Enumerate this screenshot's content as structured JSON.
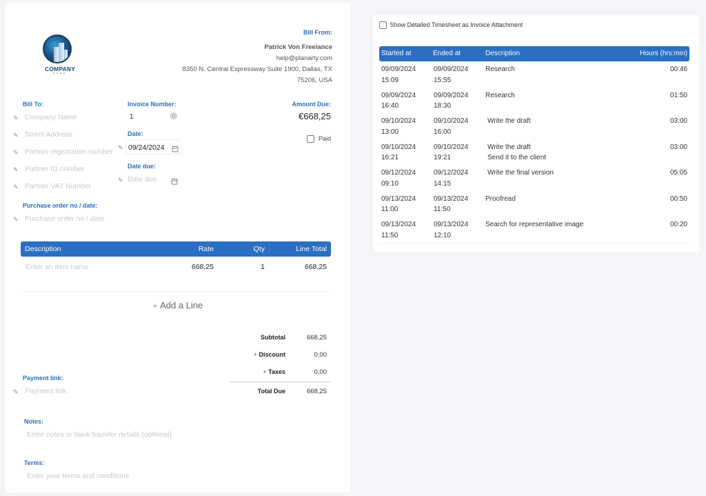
{
  "logo": {
    "name": "COMPANY",
    "sub": "NAME"
  },
  "bill_from": {
    "label": "Bill From:",
    "name": "Patrick Von Freelance",
    "email": "help@planarty.com",
    "address_line1": "8350 N. Central Expressway Suite 1900, Dallas, TX",
    "address_line2": "75206, USA"
  },
  "bill_to": {
    "label": "Bill To:",
    "fields": [
      {
        "placeholder": "Company Name",
        "value": ""
      },
      {
        "placeholder": "Street Address",
        "value": ""
      },
      {
        "placeholder": "Partner registration number",
        "value": ""
      },
      {
        "placeholder": "Partner ID number",
        "value": ""
      },
      {
        "placeholder": "Partner VAT Number",
        "value": ""
      }
    ]
  },
  "purchase_order": {
    "label": "Purchase order no / date:",
    "placeholder": "Purchase order no / date"
  },
  "invoice_number": {
    "label": "Invoice Number:",
    "value": "1"
  },
  "date": {
    "label": "Date:",
    "value": "09/24/2024"
  },
  "date_due": {
    "label": "Date due:",
    "placeholder": "Date due"
  },
  "amount_due": {
    "label": "Amount Due:",
    "value": "€668,25"
  },
  "paid": {
    "label": "Paid",
    "checked": false
  },
  "items": {
    "headers": {
      "description": "Description",
      "rate": "Rate",
      "qty": "Qty",
      "line_total": "Line Total"
    },
    "rows": [
      {
        "description_placeholder": "Enter an item name",
        "rate": "668,25",
        "qty": "1",
        "line_total": "668,25"
      }
    ],
    "add_line": "Add a Line"
  },
  "totals": {
    "subtotal_label": "Subtotal",
    "subtotal": "668,25",
    "discount_label": "Discount",
    "discount": "0,00",
    "taxes_label": "Taxes",
    "taxes": "0,00",
    "total_due_label": "Total Due",
    "total_due": "668,25",
    "plus": "+"
  },
  "payment_link": {
    "label": "Payment link:",
    "placeholder": "Payment link"
  },
  "notes": {
    "label": "Notes:",
    "placeholder": "Enter notes or bank transfer details (optional)"
  },
  "terms": {
    "label": "Terms:",
    "placeholder": "Enter your terms and conditions"
  },
  "timesheet": {
    "show_attachment_label": "Show Detailed Timesheet as Invoice Attachment",
    "show_attachment_checked": false,
    "headers": {
      "started": "Started at",
      "ended": "Ended at",
      "description": "Description",
      "hours": "Hours (hrs:min)"
    },
    "rows": [
      {
        "start_date": "09/09/2024",
        "start_time": "15:09",
        "end_date": "09/09/2024",
        "end_time": "15:55",
        "desc1": "Research",
        "desc2": "",
        "hours": "00:46"
      },
      {
        "start_date": "09/09/2024",
        "start_time": "16:40",
        "end_date": "09/09/2024",
        "end_time": "18:30",
        "desc1": "Research",
        "desc2": "",
        "hours": "01:50"
      },
      {
        "start_date": "09/10/2024",
        "start_time": "13:00",
        "end_date": "09/10/2024",
        "end_time": "16:00",
        "desc1": "Write the draft",
        "desc2": "",
        "hours": "03:00"
      },
      {
        "start_date": "09/10/2024",
        "start_time": "16:21",
        "end_date": "09/10/2024",
        "end_time": "19:21",
        "desc1": "Write the draft",
        "desc2": "Send it to the client",
        "hours": "03:00"
      },
      {
        "start_date": "09/12/2024",
        "start_time": "09:10",
        "end_date": "09/12/2024",
        "end_time": "14:15",
        "desc1": "Write the final version",
        "desc2": "",
        "hours": "05:05"
      },
      {
        "start_date": "09/13/2024",
        "start_time": "11:00",
        "end_date": "09/13/2024",
        "end_time": "11:50",
        "desc1": "Proofread",
        "desc2": "",
        "hours": "00:50"
      },
      {
        "start_date": "09/13/2024",
        "start_time": "11:50",
        "end_date": "09/13/2024",
        "end_time": "12:10",
        "desc1": "Search for representative image",
        "desc2": "",
        "hours": "00:20"
      }
    ]
  },
  "colors": {
    "accent": "#2a6fc2",
    "label": "#2d6fba",
    "background": "#f4f5f8",
    "placeholder": "#c5c8cf"
  },
  "icons": {
    "pencil": "pencil-icon",
    "gear": "gear-icon",
    "calendar": "calendar-icon",
    "plus": "plus-icon"
  }
}
